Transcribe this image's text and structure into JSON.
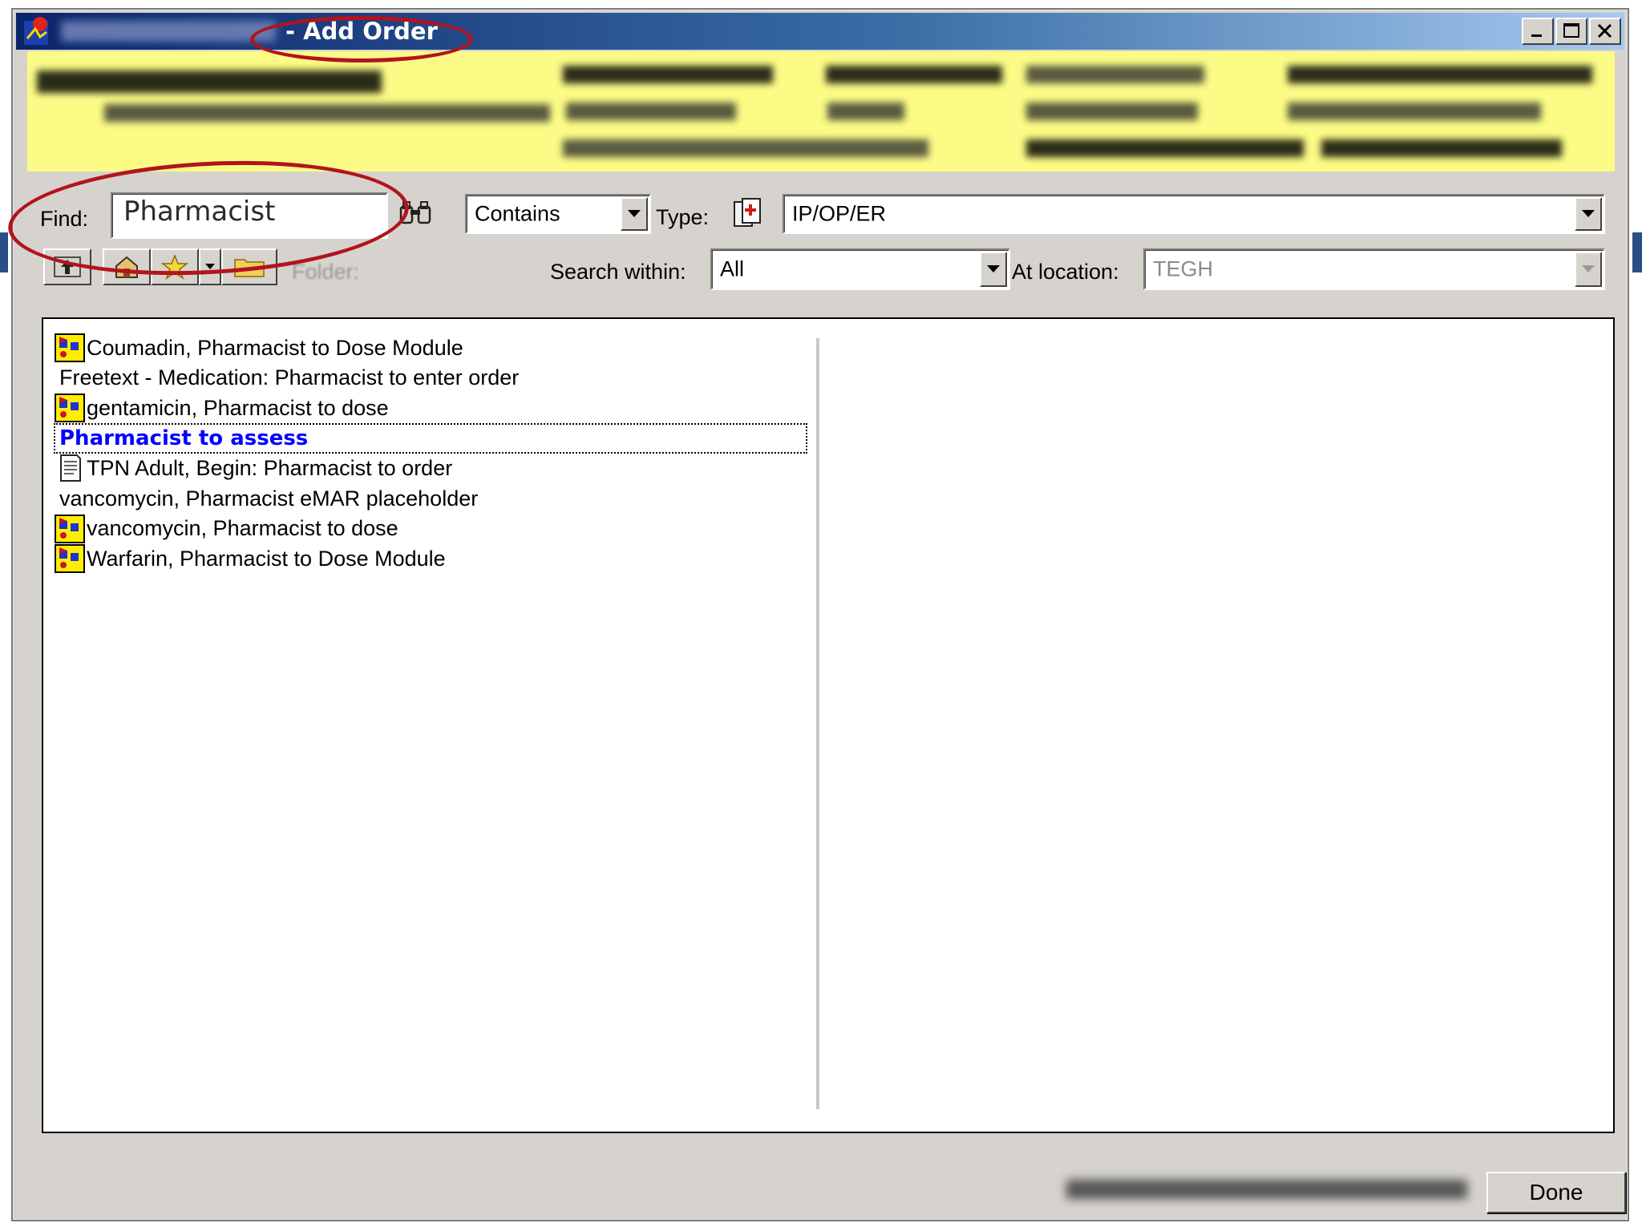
{
  "window": {
    "title": "- Add Order",
    "controls": {
      "minimize": "_",
      "maximize": "□",
      "close": "✕"
    }
  },
  "search": {
    "find_label": "Find:",
    "find_value": "Pharmacist",
    "match_mode": "Contains",
    "type_label": "Type:",
    "type_value": "IP/OP/ER",
    "search_within_label": "Search within:",
    "search_within_value": "All",
    "at_location_label": "At location:",
    "at_location_value": "TEGH",
    "folder_label": "Folder:"
  },
  "results": [
    {
      "label": "Coumadin, Pharmacist to Dose Module",
      "icon": "powerplan-icon",
      "selected": false
    },
    {
      "label": "Freetext - Medication: Pharmacist to enter order",
      "icon": "",
      "selected": false
    },
    {
      "label": "gentamicin, Pharmacist to dose",
      "icon": "powerplan-icon",
      "selected": false
    },
    {
      "label": "Pharmacist to assess",
      "icon": "",
      "selected": true
    },
    {
      "label": "TPN Adult, Begin: Pharmacist to order",
      "icon": "order-sheet-icon",
      "selected": false
    },
    {
      "label": "vancomycin, Pharmacist eMAR placeholder",
      "icon": "",
      "selected": false
    },
    {
      "label": "vancomycin, Pharmacist to dose",
      "icon": "powerplan-icon",
      "selected": false
    },
    {
      "label": "Warfarin, Pharmacist to Dose Module",
      "icon": "powerplan-icon",
      "selected": false
    }
  ],
  "footer": {
    "done_label": "Done"
  },
  "colors": {
    "banner": "#fbfb86",
    "annotation": "#b2141e",
    "selected_text": "#0000ff",
    "titlebar_start": "#0a246a"
  }
}
